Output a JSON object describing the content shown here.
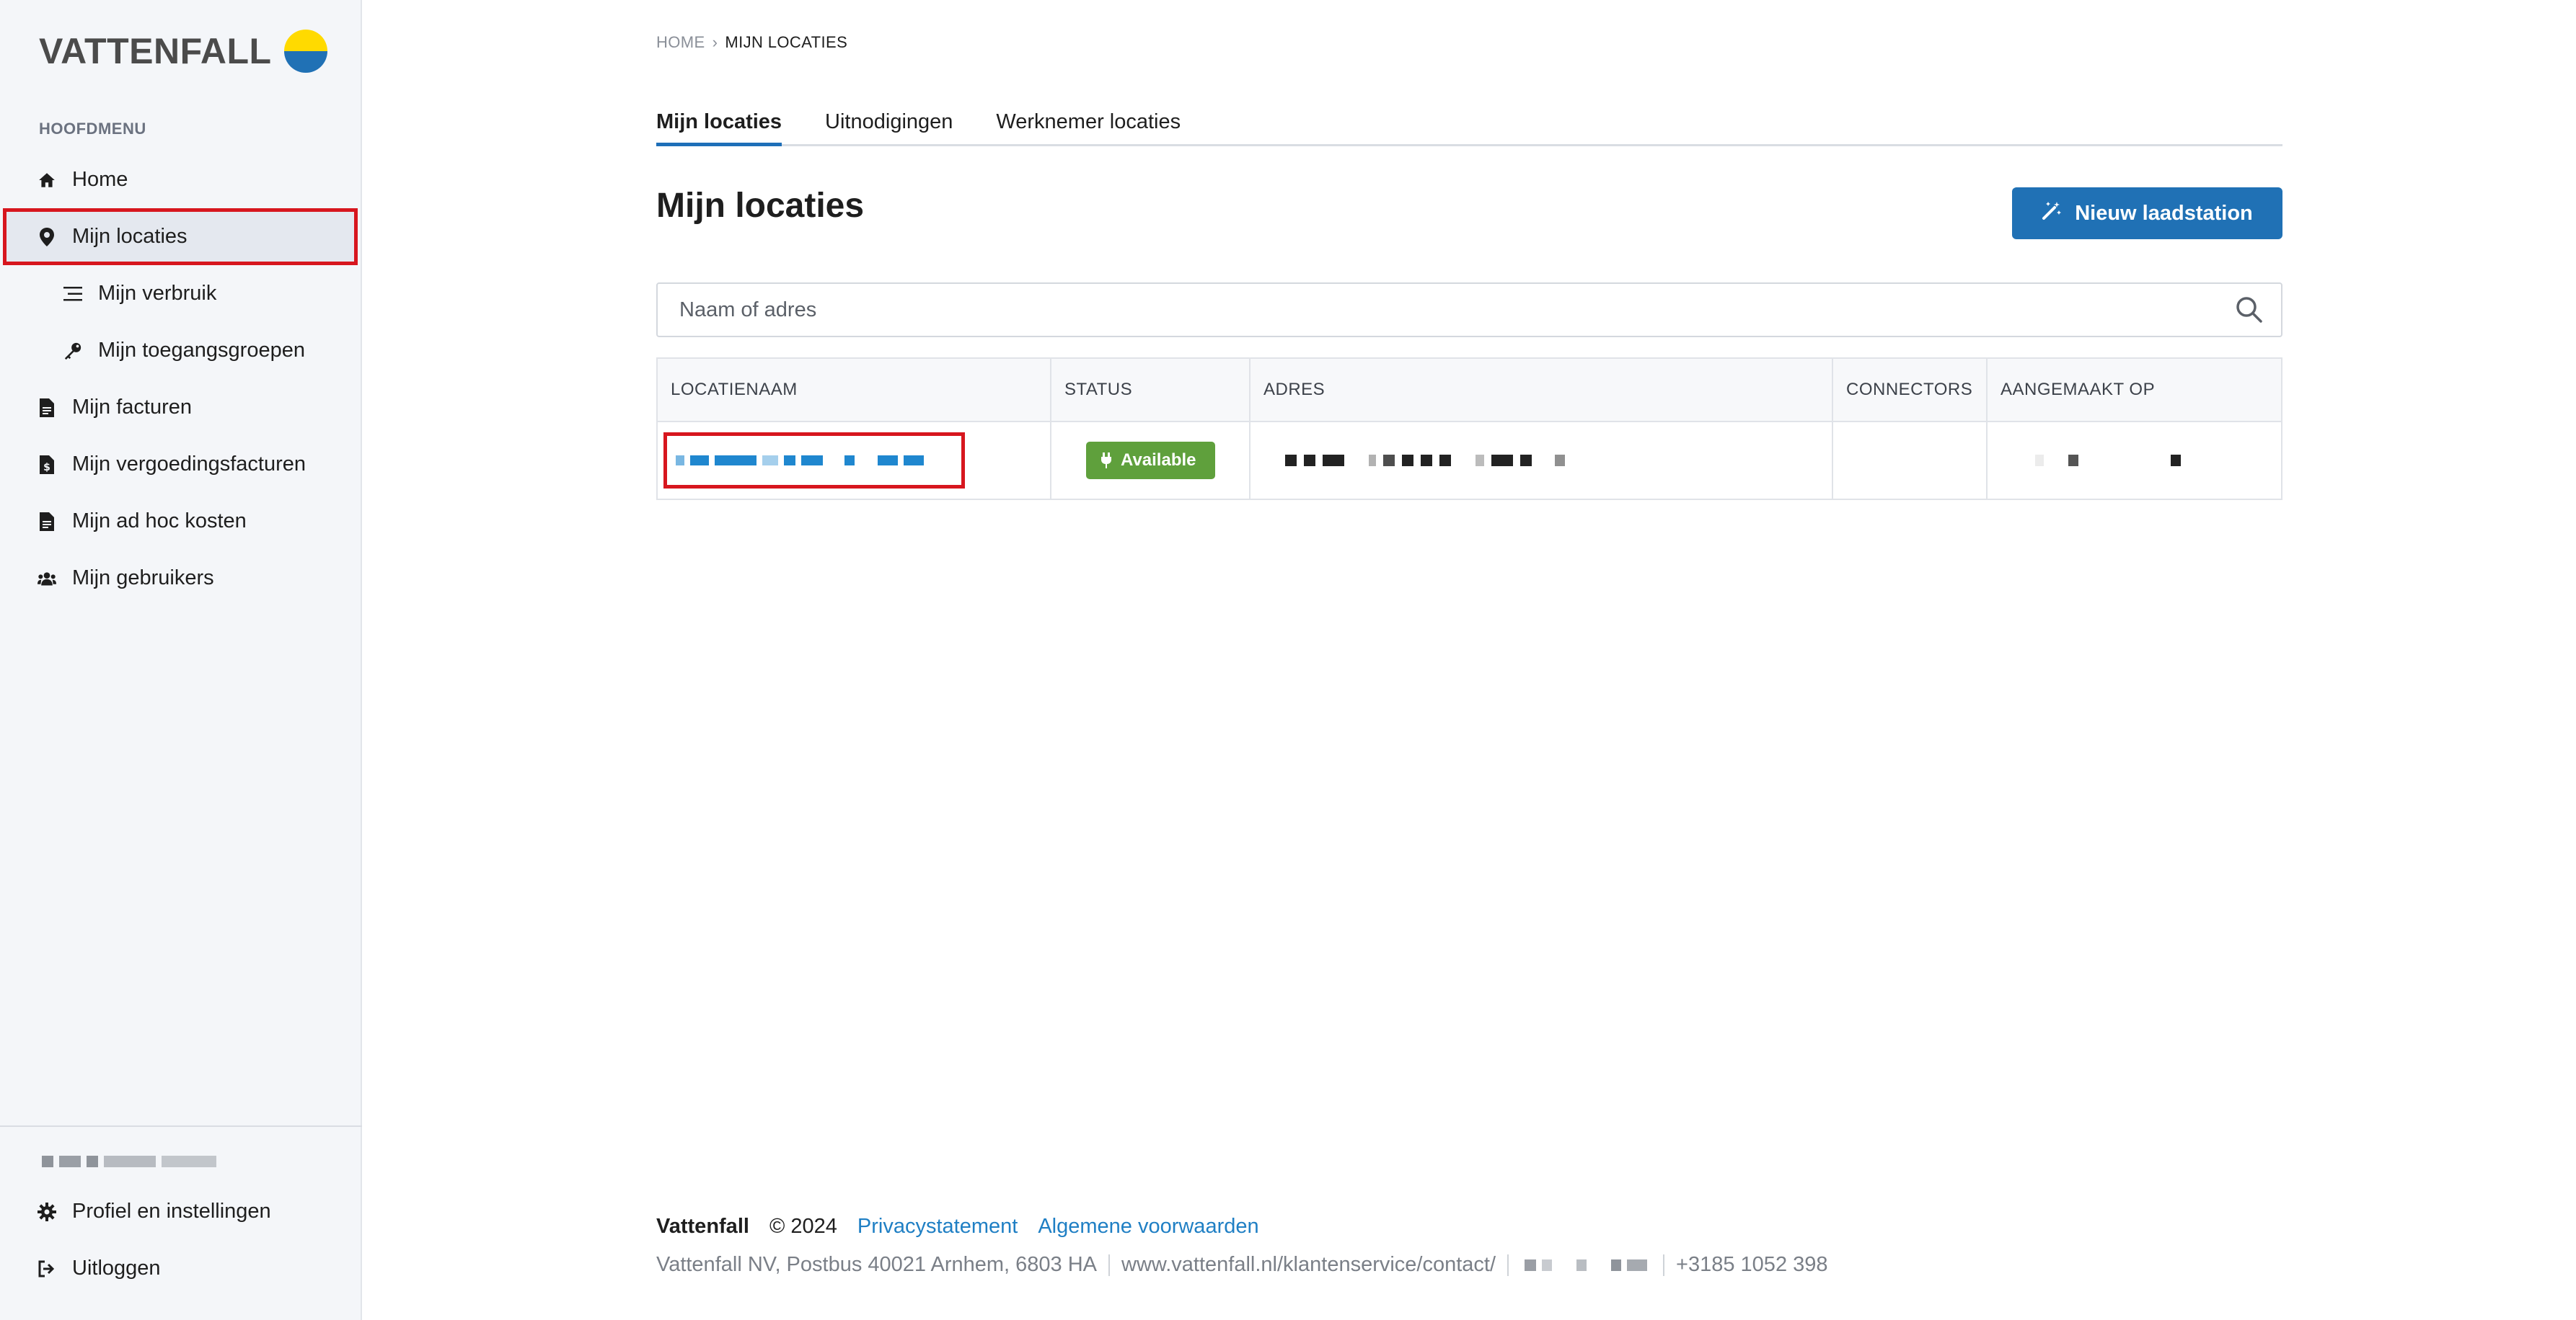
{
  "brand": {
    "logo_text": "VATTENFALL"
  },
  "sidebar": {
    "section_label": "HOOFDMENU",
    "items": [
      {
        "label": "Home",
        "icon": "home-icon"
      },
      {
        "label": "Mijn locaties",
        "icon": "map-pin-icon",
        "active": true
      },
      {
        "label": "Mijn verbruik",
        "icon": "list-icon",
        "sub": true
      },
      {
        "label": "Mijn toegangsgroepen",
        "icon": "key-icon",
        "sub": true
      },
      {
        "label": "Mijn facturen",
        "icon": "document-icon"
      },
      {
        "label": "Mijn vergoedingsfacturen",
        "icon": "document-dollar-icon"
      },
      {
        "label": "Mijn ad hoc kosten",
        "icon": "document-icon"
      },
      {
        "label": "Mijn gebruikers",
        "icon": "users-icon"
      }
    ],
    "bottom_items": [
      {
        "label": "Profiel en instellingen",
        "icon": "gear-icon"
      },
      {
        "label": "Uitloggen",
        "icon": "logout-icon"
      }
    ]
  },
  "breadcrumb": {
    "home": "HOME",
    "current": "MIJN LOCATIES"
  },
  "tabs": [
    {
      "label": "Mijn locaties",
      "active": true
    },
    {
      "label": "Uitnodigingen"
    },
    {
      "label": "Werknemer locaties"
    }
  ],
  "page": {
    "title": "Mijn locaties",
    "new_button": "Nieuw laadstation",
    "search_placeholder": "Naam of adres"
  },
  "table": {
    "columns": [
      "LOCATIENAAM",
      "STATUS",
      "ADRES",
      "CONNECTORS",
      "AANGEMAAKT OP"
    ],
    "rows": [
      {
        "status": "Available",
        "connectors": ""
      }
    ]
  },
  "footer": {
    "brand": "Vattenfall",
    "copyright": "© 2024",
    "privacy": "Privacystatement",
    "terms": "Algemene voorwaarden",
    "address": "Vattenfall NV, Postbus 40021 Arnhem, 6803 HA",
    "url": "www.vattenfall.nl/klantenservice/contact/",
    "phone": "+3185 1052 398"
  },
  "colors": {
    "accent": "#2071b5",
    "status_available": "#5fa03c",
    "link": "#1f7fc4",
    "highlight": "#d7161e"
  }
}
